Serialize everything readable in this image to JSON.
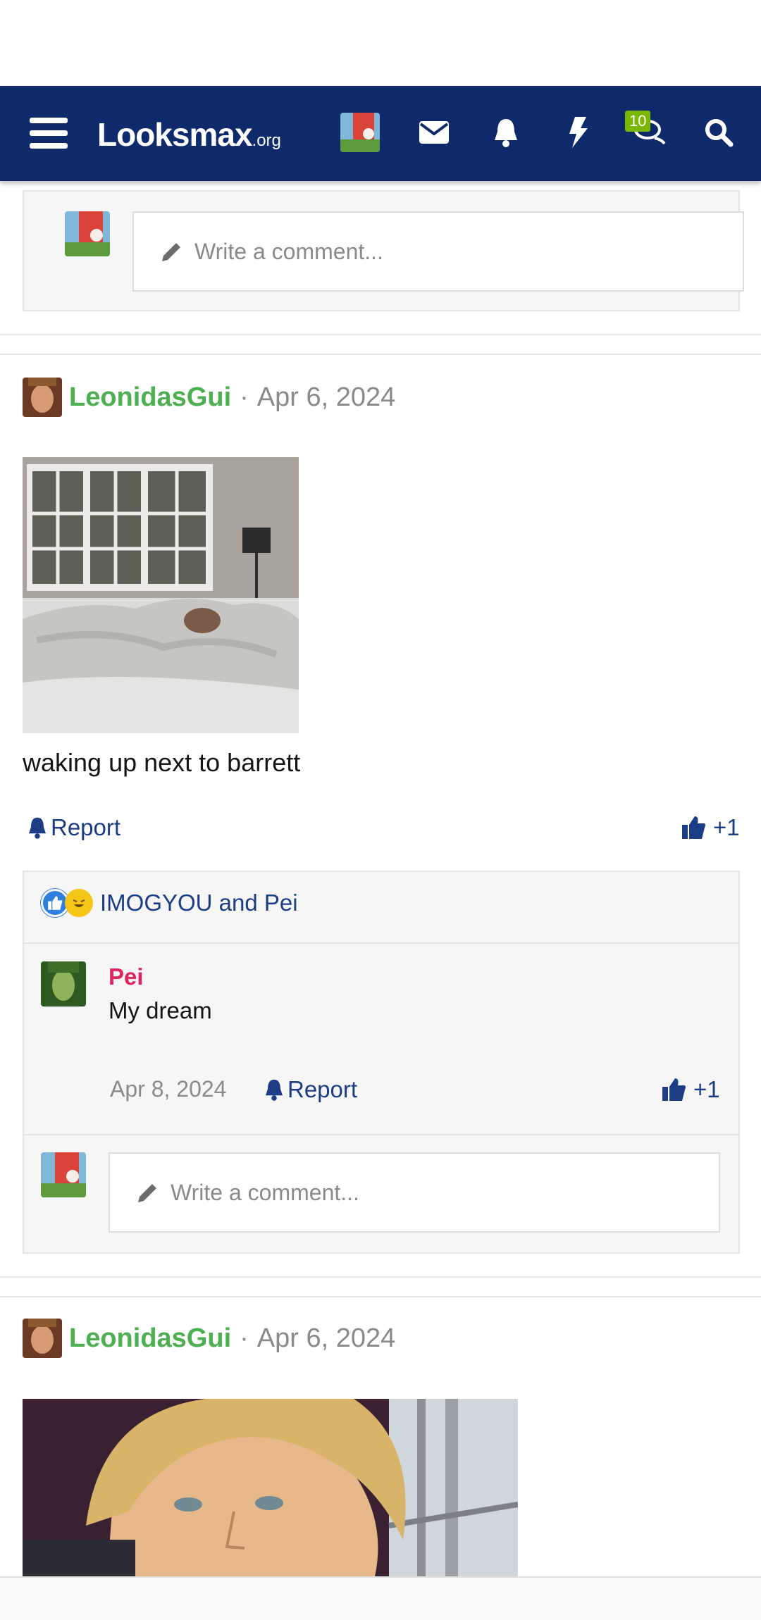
{
  "nav": {
    "logo_main": "Looksmax",
    "logo_suffix": ".org",
    "badge_count": "10",
    "icons": [
      "menu-icon",
      "avatar",
      "envelope-icon",
      "bell-icon",
      "bolt-icon",
      "chat-icon",
      "search-icon"
    ]
  },
  "comment_box": {
    "placeholder": "Write a comment..."
  },
  "posts": [
    {
      "username": "LeonidasGui",
      "date": "Apr 6, 2024",
      "caption": "waking up next to barrett",
      "report_label": "Report",
      "likes": "+1",
      "reactions_text": "IMOGYOU and Pei",
      "reply": {
        "username": "Pei",
        "text": "My dream",
        "date": "Apr 8, 2024",
        "report_label": "Report",
        "likes": "+1"
      }
    },
    {
      "username": "LeonidasGui",
      "date": "Apr 6, 2024"
    }
  ],
  "separator": "·",
  "colors": {
    "nav": "#0f2a6b",
    "username": "#4caf50",
    "link": "#1c3d86",
    "reply_user": "#e0245e",
    "badge": "#7ab800"
  }
}
